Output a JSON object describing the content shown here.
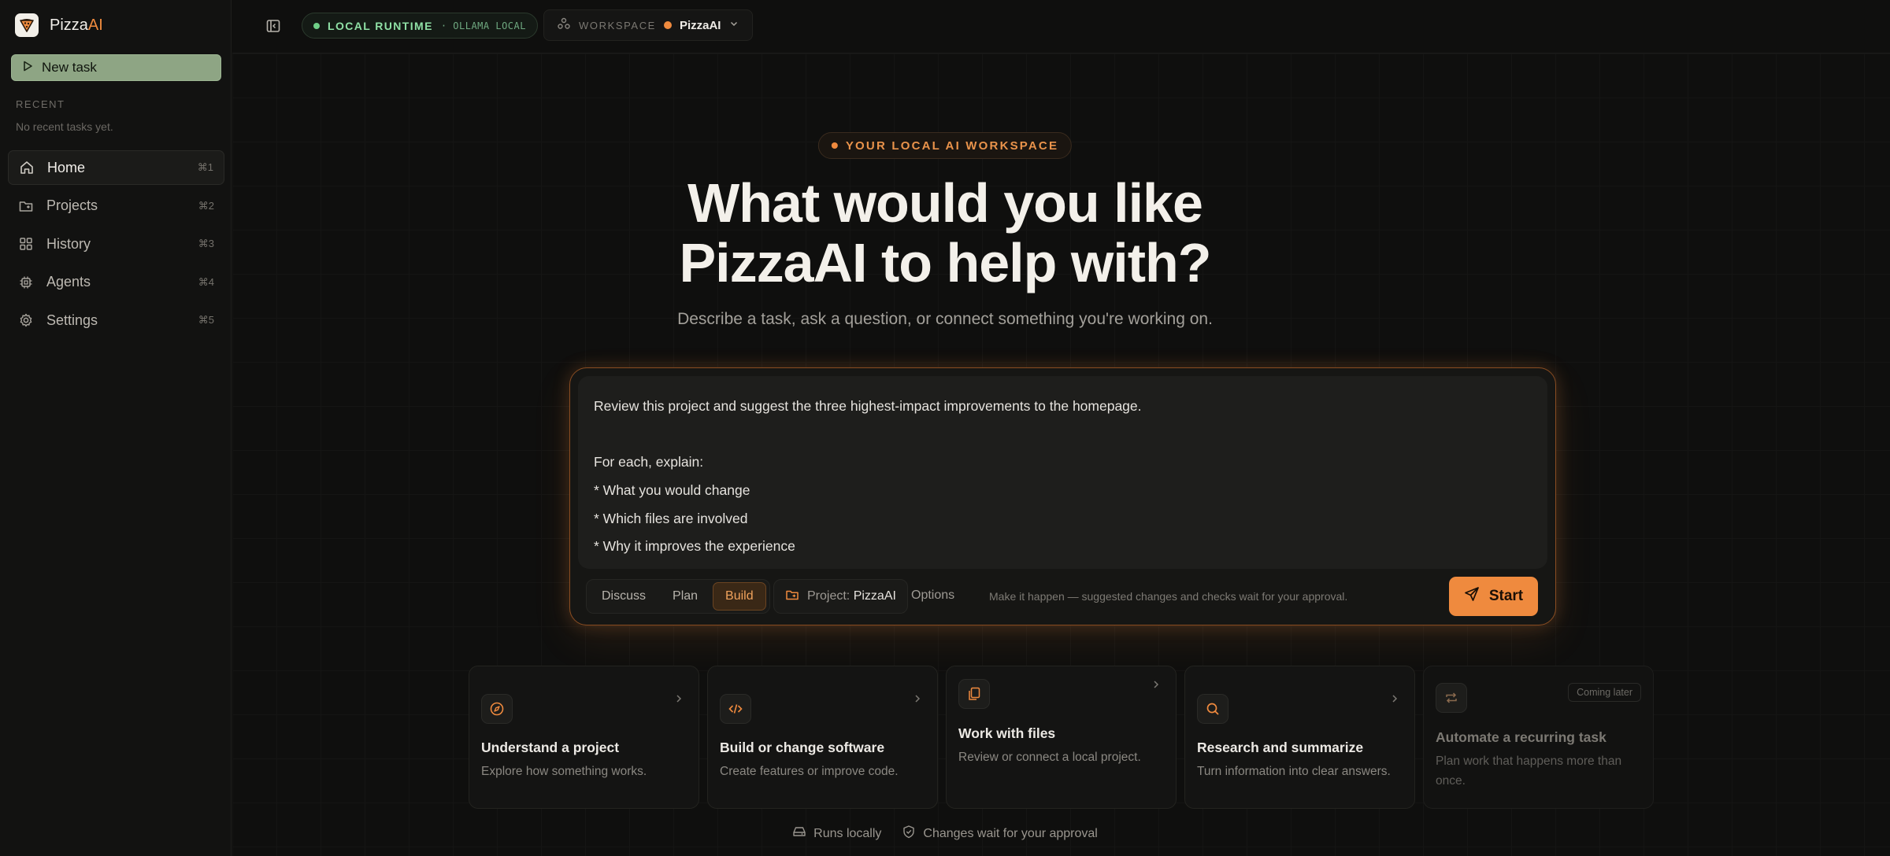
{
  "brand": {
    "name_prefix": "Pizza",
    "name_suffix": "AI"
  },
  "sidebar": {
    "new_task_label": "New task",
    "recent_label": "RECENT",
    "recent_empty": "No recent tasks yet.",
    "items": [
      {
        "label": "Home",
        "shortcut": "⌘1",
        "icon": "home-icon",
        "active": true
      },
      {
        "label": "Projects",
        "shortcut": "⌘2",
        "icon": "folder-icon"
      },
      {
        "label": "History",
        "shortcut": "⌘3",
        "icon": "grid-icon"
      },
      {
        "label": "Agents",
        "shortcut": "⌘4",
        "icon": "chip-icon"
      },
      {
        "label": "Settings",
        "shortcut": "⌘5",
        "icon": "gear-icon"
      }
    ]
  },
  "topbar": {
    "runtime_label": "LOCAL RUNTIME",
    "runtime_sub": "· OLLAMA LOCAL",
    "workspace_label": "WORKSPACE",
    "workspace_name": "PizzaAI"
  },
  "hero": {
    "eyebrow": "YOUR LOCAL AI WORKSPACE",
    "title_line1": "What would you like",
    "title_line2": "PizzaAI to help with?",
    "subtitle": "Describe a task, ask a question, or connect something you're working on."
  },
  "composer": {
    "prompt_lines": [
      "Review this project and suggest the three highest-impact improvements to the homepage.",
      "",
      "For each, explain:",
      "* What you would change",
      "* Which files are involved",
      "* Why it improves the experience"
    ],
    "modes": [
      "Discuss",
      "Plan",
      "Build"
    ],
    "selected_mode": "Build",
    "project_prefix": "Project:",
    "project_name": "PizzaAI",
    "options_label": "Options",
    "hint": "Make it happen — suggested changes and checks wait for your approval.",
    "start_label": "Start"
  },
  "cards": [
    {
      "title": "Understand a project",
      "desc": "Explore how something works.",
      "icon": "compass-icon"
    },
    {
      "title": "Build or change software",
      "desc": "Create features or improve code.",
      "icon": "code-icon"
    },
    {
      "title": "Work with files",
      "desc": "Review or connect a local project.",
      "icon": "files-icon"
    },
    {
      "title": "Research and summarize",
      "desc": "Turn information into clear answers.",
      "icon": "search-icon"
    },
    {
      "title": "Automate a recurring task",
      "desc": "Plan work that happens more than once.",
      "icon": "repeat-icon",
      "badge": "Coming later"
    }
  ],
  "footer": {
    "runs_locally": "Runs locally",
    "approval": "Changes wait for your approval"
  },
  "colors": {
    "accent": "#ef8a3e",
    "green": "#6fcf87",
    "sage": "#8ea584",
    "bg": "#0f0f0e"
  }
}
